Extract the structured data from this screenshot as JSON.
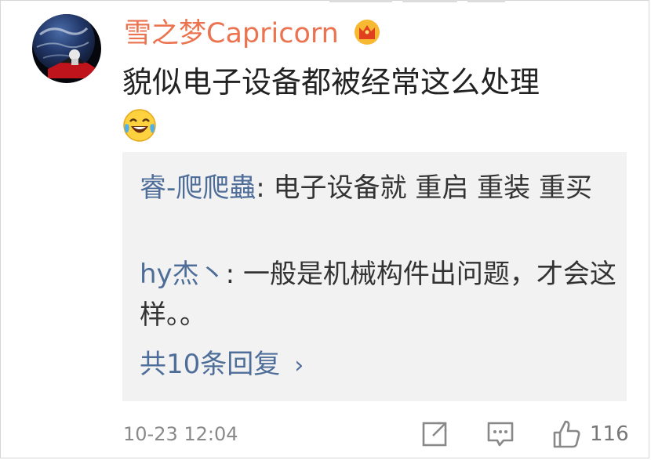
{
  "comment": {
    "username": "雪之梦Capricorn",
    "user_badge_icon": "crown-icon",
    "text": "貌似电子设备都被经常这么处理",
    "emoji_icon": "laugh-cry-emoji-icon",
    "timestamp": "10-23 12:04"
  },
  "replies": [
    {
      "name": "睿-爬爬蟲",
      "separator": ": ",
      "text": "电子设备就 重启 重装 重买"
    },
    {
      "name": "hy杰丶",
      "separator": ": ",
      "text": "一般是机械构件出问题，才会这样。。"
    }
  ],
  "more_replies": {
    "label": "共10条回复",
    "chevron": "›"
  },
  "actions": {
    "share_icon": "share-icon",
    "comment_icon": "comment-icon",
    "like_icon": "thumbs-up-icon",
    "like_count": "116"
  },
  "colors": {
    "username": "#eb7350",
    "reply_name": "#4e6e99",
    "reply_box_bg": "#f2f2f2",
    "meta_gray": "#8a8a8a"
  }
}
